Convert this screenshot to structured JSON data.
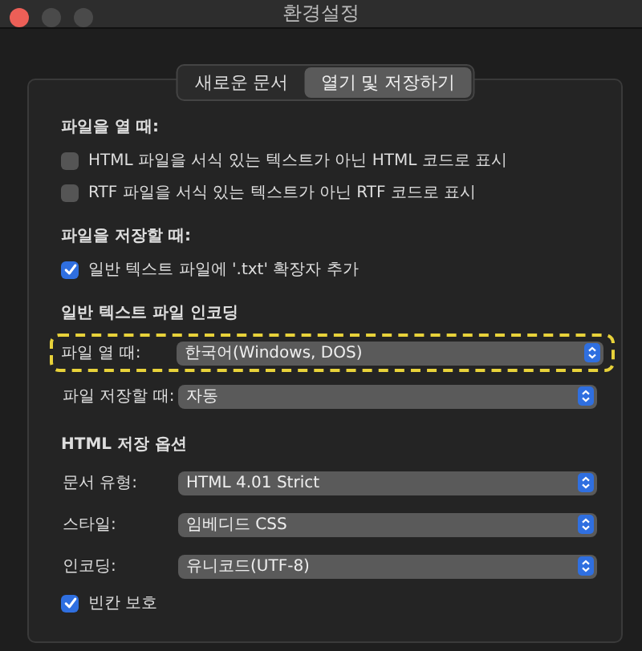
{
  "window": {
    "title": "환경설정"
  },
  "tabs": [
    {
      "label": "새로운 문서",
      "selected": false
    },
    {
      "label": "열기 및 저장하기",
      "selected": true
    }
  ],
  "sections": [
    {
      "heading": "파일을 열 때:",
      "items": [
        {
          "kind": "checkbox",
          "label": "HTML 파일을 서식 있는 텍스트가 아닌 HTML 코드로 표시",
          "checked": false
        },
        {
          "kind": "checkbox",
          "label": "RTF 파일을 서식 있는 텍스트가 아닌 RTF 코드로 표시",
          "checked": false
        }
      ]
    },
    {
      "heading": "파일을 저장할 때:",
      "items": [
        {
          "kind": "checkbox",
          "label": "일반 텍스트 파일에 '.txt' 확장자 추가",
          "checked": true
        }
      ]
    },
    {
      "heading": "일반 텍스트 파일 인코딩",
      "items": [
        {
          "kind": "popup",
          "label": "파일 열 때:",
          "value": "한국어(Windows, DOS)",
          "highlighted": true
        },
        {
          "kind": "popup",
          "label": "파일 저장할 때:",
          "value": "자동",
          "highlighted": false
        }
      ]
    },
    {
      "heading": "HTML 저장 옵션",
      "items": [
        {
          "kind": "popup",
          "label": "문서 유형:",
          "value": "HTML 4.01 Strict",
          "highlighted": false
        },
        {
          "kind": "popup",
          "label": "스타일:",
          "value": "임베디드 CSS",
          "highlighted": false
        },
        {
          "kind": "popup",
          "label": "인코딩:",
          "value": "유니코드(UTF-8)",
          "highlighted": false
        },
        {
          "kind": "checkbox",
          "label": "빈칸 보호",
          "checked": true
        }
      ]
    }
  ]
}
